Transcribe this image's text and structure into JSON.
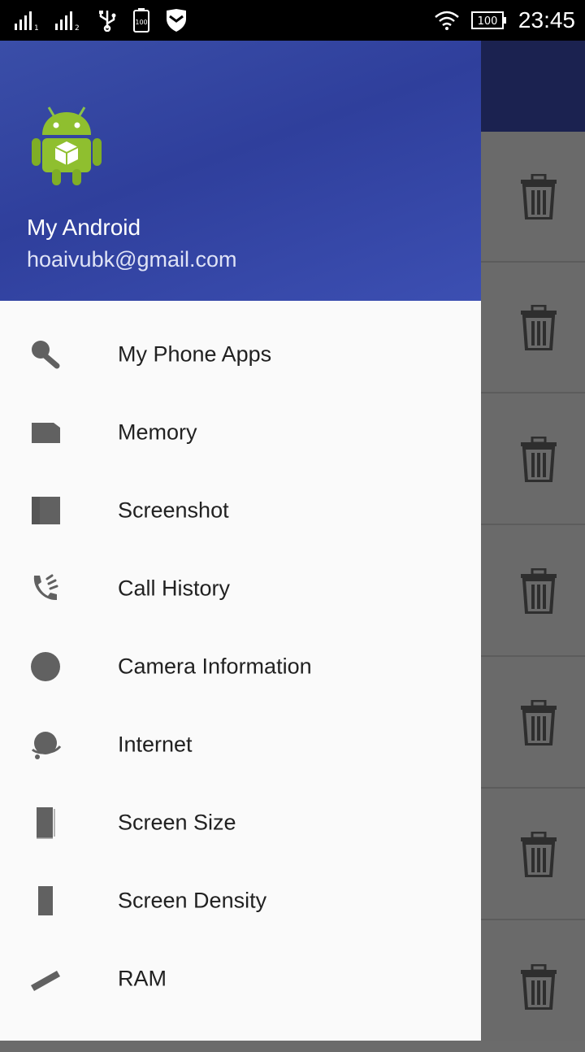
{
  "status_bar": {
    "time": "23:45",
    "battery": "100",
    "icons": [
      "signal-1-icon",
      "signal-2-icon",
      "usb-icon",
      "battery-saver-icon",
      "shield-icon",
      "wifi-icon",
      "battery-icon"
    ]
  },
  "drawer": {
    "header": {
      "name": "My Android",
      "email": "hoaivubk@gmail.com",
      "avatar_icon": "android-robot-icon"
    },
    "items": [
      {
        "label": "My Phone Apps",
        "icon": "search-icon"
      },
      {
        "label": "Memory",
        "icon": "sd-card-icon"
      },
      {
        "label": "Screenshot",
        "icon": "screenshot-icon"
      },
      {
        "label": "Call History",
        "icon": "phone-call-icon"
      },
      {
        "label": "Camera Information",
        "icon": "camera-circle-icon"
      },
      {
        "label": "Internet",
        "icon": "globe-icon"
      },
      {
        "label": "Screen Size",
        "icon": "phone-size-icon"
      },
      {
        "label": "Screen Density",
        "icon": "phone-density-icon"
      },
      {
        "label": "RAM",
        "icon": "ram-stick-icon"
      }
    ]
  },
  "background_list": {
    "row_icon": "trash-icon",
    "row_count": 7
  },
  "colors": {
    "header_gradient_start": "#3a4ea8",
    "header_gradient_end": "#3c4fb2",
    "appbar": "#1b2250",
    "scrim": "#6a6a6a",
    "drawer_bg": "#fafafa"
  }
}
